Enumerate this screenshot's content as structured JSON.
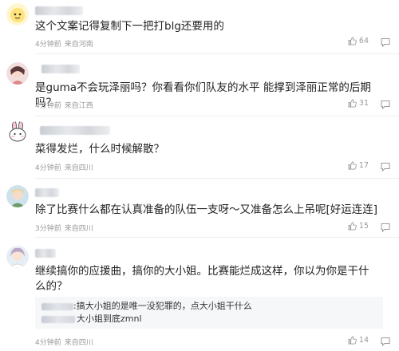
{
  "comments": [
    {
      "name_prefix": "",
      "text": "这个文案记得复制下一把打blg还要用的",
      "time": "4分钟前",
      "location": "来自河南",
      "likes": "64"
    },
    {
      "name_prefix": "",
      "text": "是guma不会玩泽丽吗？你看看你们队友的水平 能撑到泽丽正常的后期吗？",
      "time": "4分钟前",
      "location": "来自江西",
      "likes": "31"
    },
    {
      "name_prefix": "",
      "text": "菜得发烂，什么时候解散？",
      "time": "4分钟前",
      "location": "来自四川",
      "likes": "17"
    },
    {
      "name_prefix": "",
      "text": "除了比赛什么都在认真准备的队伍一支呀～又准备怎么上吊呢[好运连连]",
      "time": "3分钟前",
      "location": "来自四川",
      "likes": "15"
    },
    {
      "name_prefix": "",
      "text": "继续搞你的应援曲，搞你的大小姐。比赛能烂成这样，你以为你是干什么的？",
      "time": "4分钟前",
      "location": "来自四川",
      "likes": "14",
      "replies": [
        {
          "text": ":搞大小姐的是唯一没犯罪的，点大小姐干什么"
        },
        {
          "text": "大小姐到底zmnl"
        }
      ]
    }
  ],
  "colors": {
    "text": "#222222",
    "meta": "#999999",
    "divider": "#eeeeee",
    "reply_bg": "#f6f7f8"
  },
  "icons": {
    "like": "thumbs-up-icon",
    "reply": "comment-bubble-icon"
  }
}
